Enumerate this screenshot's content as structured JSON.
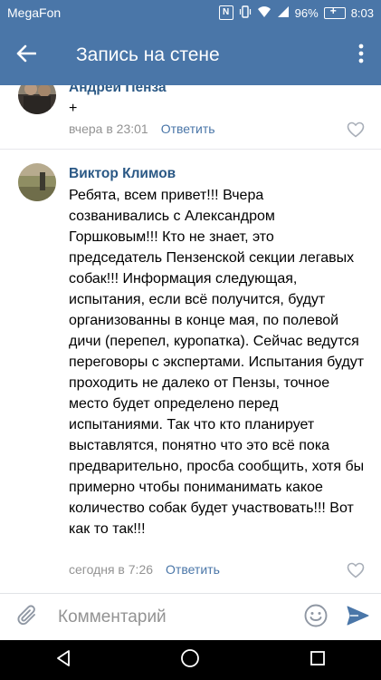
{
  "status_bar": {
    "carrier": "MegaFon",
    "battery": "96%",
    "time": "8:03"
  },
  "toolbar": {
    "title": "Запись на стене"
  },
  "comments": [
    {
      "author": "Андрей Пенза",
      "text": "+",
      "time": "вчера в 23:01",
      "reply": "Ответить"
    },
    {
      "author": "Виктор Климов",
      "text": "Ребята, всем привет!!! Вчера созванивались с Александром Горшковым!!! Кто не знает, это председатель Пензенской секции легавых собак!!! Информация следующая, испытания, если всё получится, будут организованны в конце мая, по полевой дичи (перепел, куропатка). Сейчас ведутся переговоры с экспертами. Испытания будут проходить не далеко от Пензы, точное место будет определено перед испытаниями. Так что кто планирует выставлятся, понятно что это всё пока предварительно, просба сообщить, хотя бы примерно  чтобы пониманимать какое количество собак будет участвовать!!! Вот как то так!!!",
      "time": "сегодня в 7:26",
      "reply": "Ответить"
    }
  ],
  "composer": {
    "placeholder": "Комментарий"
  },
  "colors": {
    "header": "#4a76a8",
    "link": "#2a5885",
    "meta": "#939393"
  }
}
